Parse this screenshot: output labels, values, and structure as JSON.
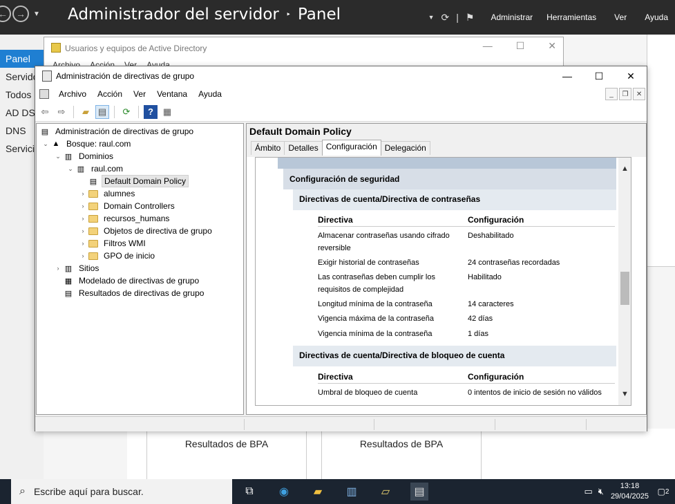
{
  "server_manager": {
    "title": "Administrador del servidor",
    "breadcrumb_sep": "‣",
    "page": "Panel",
    "menu": [
      "Administrar",
      "Herramientas",
      "Ver",
      "Ayuda"
    ],
    "sidebar": [
      "Panel",
      "Servidor local",
      "Todos los servidores",
      "AD DS",
      "DNS",
      "Servicios de archivos"
    ],
    "bpa": [
      "Resultados de BPA",
      "Resultados de BPA"
    ]
  },
  "ad_window": {
    "title": "Usuarios y equipos de Active Directory",
    "menu": [
      "Archivo",
      "Acción",
      "Ver",
      "Ayuda"
    ]
  },
  "gpmc": {
    "title": "Administración de directivas de grupo",
    "menu": [
      "Archivo",
      "Acción",
      "Ver",
      "Ventana",
      "Ayuda"
    ],
    "tree": {
      "root": "Administración de directivas de grupo",
      "forest": "Bosque: raul.com",
      "domains": "Dominios",
      "domain": "raul.com",
      "gpo": "Default Domain Policy",
      "ou1": "alumnes",
      "ou2": "Domain Controllers",
      "ou3": "recursos_humans",
      "gpo_objects": "Objetos de directiva de grupo",
      "wmi": "Filtros WMI",
      "starter": "GPO de inicio",
      "sites": "Sitios",
      "modeling": "Modelado de directivas de grupo",
      "results": "Resultados de directivas de grupo"
    },
    "panel": {
      "title": "Default Domain Policy",
      "tabs": [
        "Ámbito",
        "Detalles",
        "Configuración",
        "Delegación"
      ],
      "section": "Configuración de seguridad",
      "password_heading": "Directivas de cuenta/Directiva de contraseñas",
      "lockout_heading": "Directivas de cuenta/Directiva de bloqueo de cuenta",
      "col_policy": "Directiva",
      "col_setting": "Configuración",
      "password_rows": [
        {
          "k": "Almacenar contraseñas usando cifrado reversible",
          "v": "Deshabilitado"
        },
        {
          "k": "Exigir historial de contraseñas",
          "v": "24 contraseñas recordadas"
        },
        {
          "k": "Las contraseñas deben cumplir los requisitos de complejidad",
          "v": "Habilitado"
        },
        {
          "k": "Longitud mínima de la contraseña",
          "v": "14 caracteres"
        },
        {
          "k": "Vigencia máxima de la contraseña",
          "v": "42 días"
        },
        {
          "k": "Vigencia mínima de la contraseña",
          "v": "1 días"
        }
      ],
      "lockout_rows": [
        {
          "k": "Umbral de bloqueo de cuenta",
          "v": "0 intentos de inicio de sesión no válidos"
        }
      ]
    }
  },
  "taskbar": {
    "search_placeholder": "Escribe aquí para buscar.",
    "time": "13:18",
    "date": "29/04/2025",
    "notifications": "2"
  }
}
